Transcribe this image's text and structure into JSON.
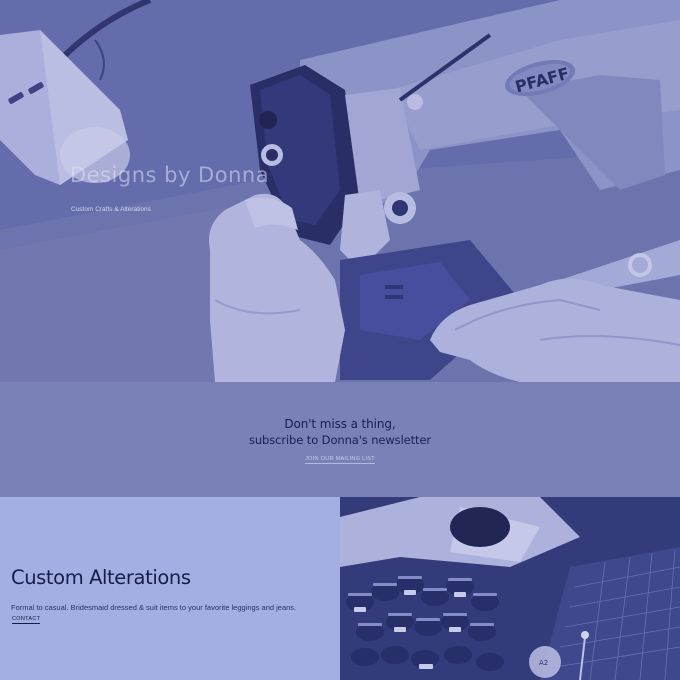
{
  "hero": {
    "title": "Designs by Donna",
    "subtitle": "Custom Crafts & Alterations",
    "machine_brand": "PFAFF"
  },
  "newsletter": {
    "line1": "Don't miss a thing,",
    "line2": "subscribe to Donna's newsletter",
    "join_label": "JOIN OUR MAILING LIST"
  },
  "alterations": {
    "heading": "Custom Alterations",
    "description": "Formal to casual. Bridesmaid dressed & suit items to your favorite leggings and jeans.",
    "contact_label": "CONTACT"
  },
  "colors": {
    "hero_tint": "#6d75b0",
    "newsletter_bg": "#7a81b6",
    "alterations_bg": "#a4aee3",
    "text_dark": "#1a1f50"
  }
}
